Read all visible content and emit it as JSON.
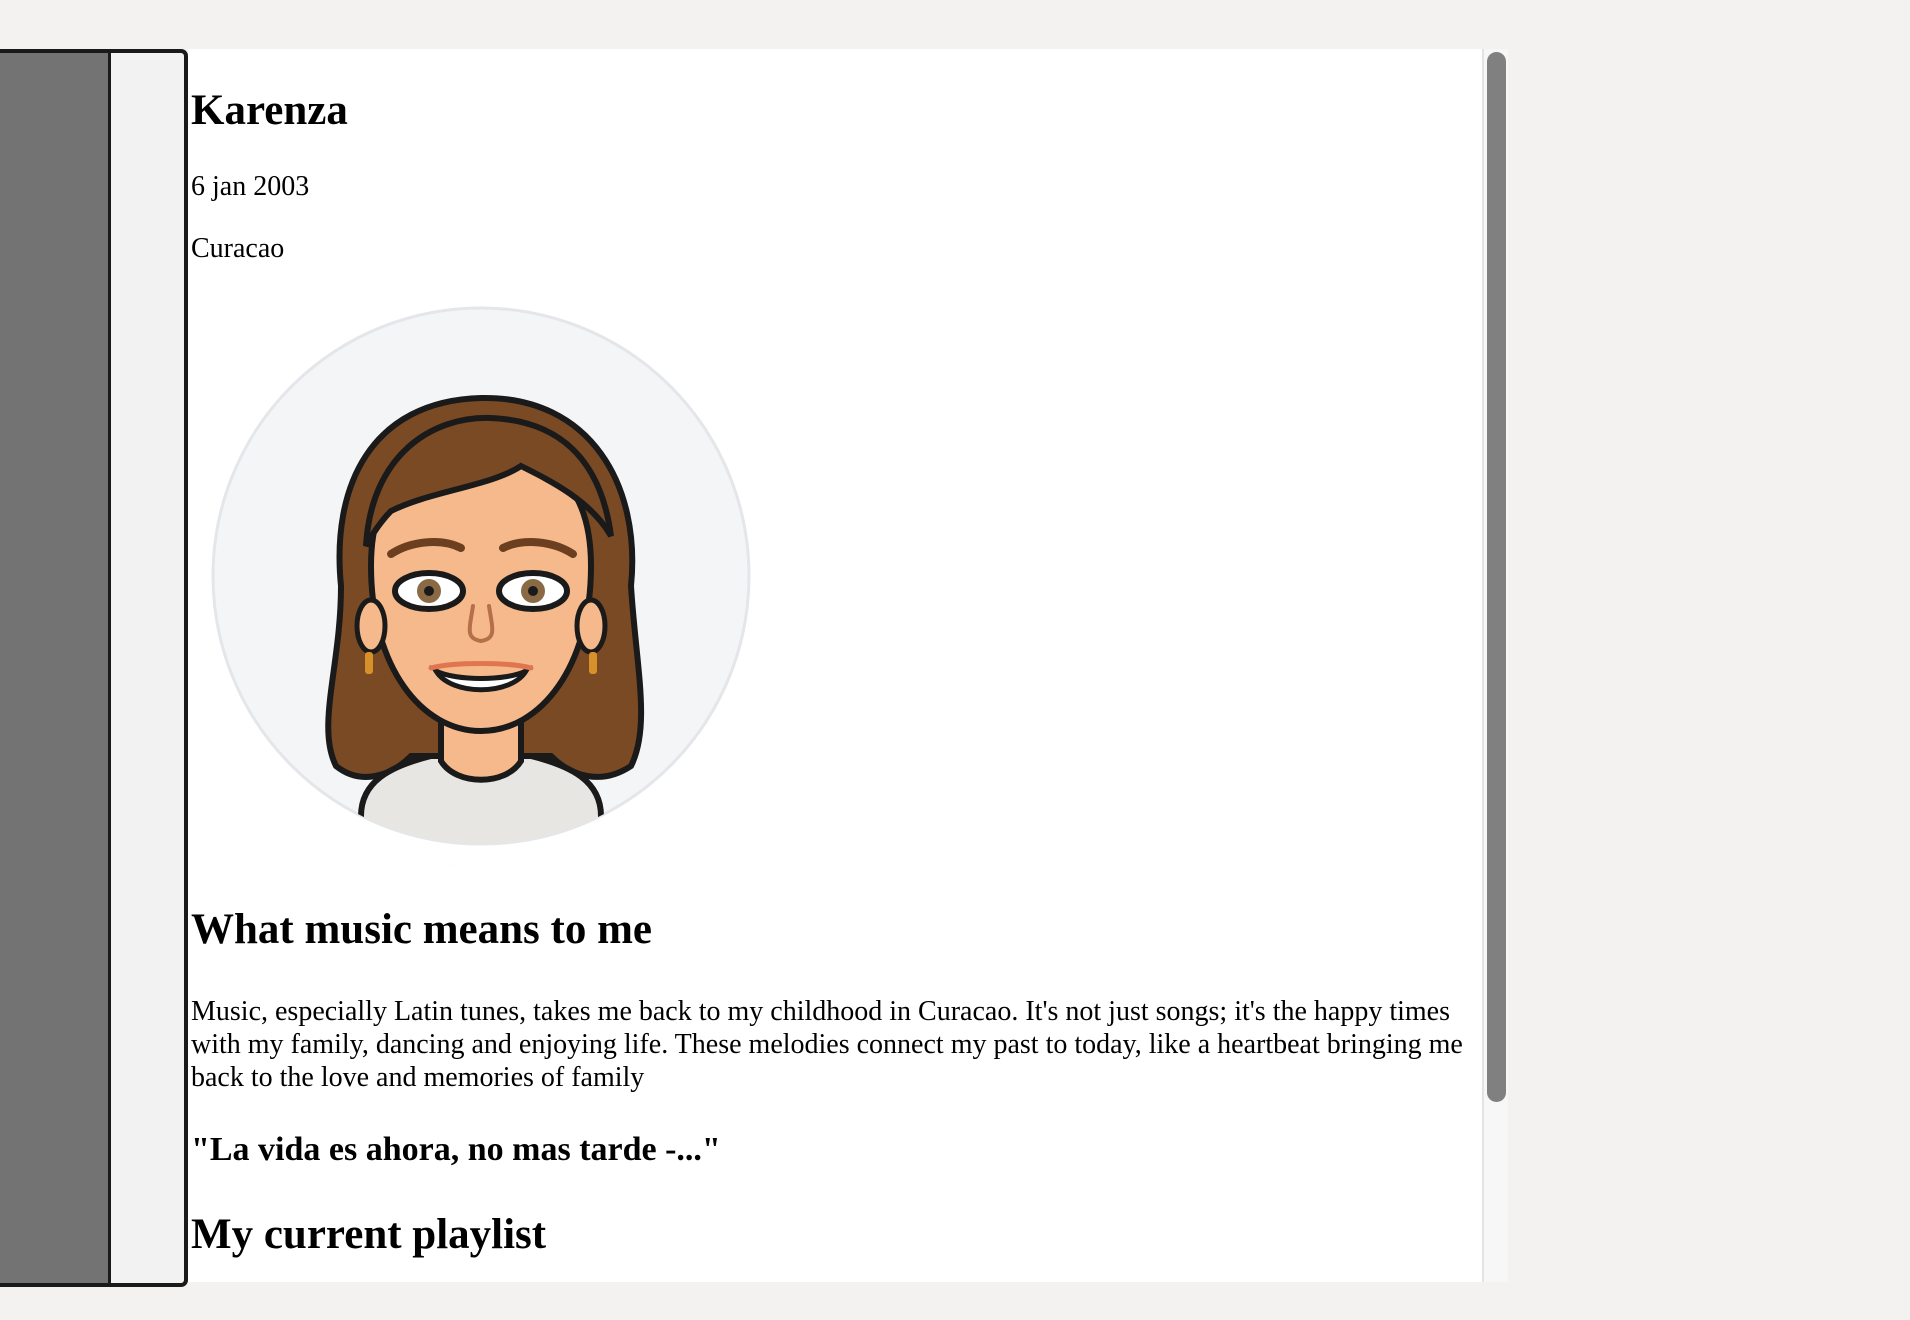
{
  "profile": {
    "name": "Karenza",
    "birth_date": "6 jan 2003",
    "location": "Curacao"
  },
  "avatar": {
    "icon": "bitmoji-avatar-icon",
    "colors": {
      "hair": "#7a4a25",
      "skin": "#f6b98b",
      "background": "#f4f5f7",
      "shirt": "#e8e6e3"
    }
  },
  "music_section": {
    "heading": "What music means to me",
    "text": "Music, especially Latin tunes, takes me back to my childhood in Curacao. It's not just songs; it's the happy times with my family, dancing and enjoying life. These melodies connect my past to today, like a heartbeat bringing me back to the love and memories of family"
  },
  "quote": "\"La vida es ahora, no mas tarde -...\"",
  "playlist": {
    "heading": "My current playlist"
  },
  "colors": {
    "left_panel": "#737373",
    "scrollbar_thumb": "#808080",
    "page_background": "#f3f2f0"
  }
}
